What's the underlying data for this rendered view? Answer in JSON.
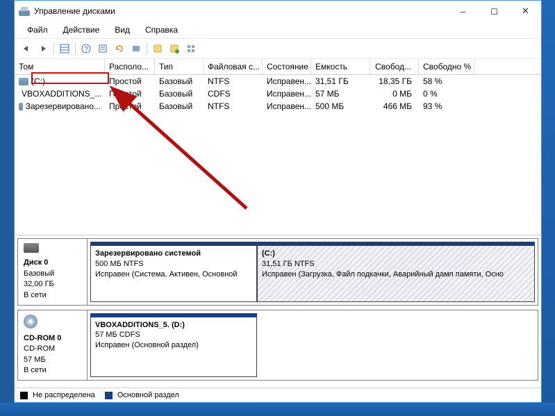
{
  "window": {
    "title": "Управление дисками"
  },
  "menu": {
    "file": "Файл",
    "action": "Действие",
    "view": "Вид",
    "help": "Справка"
  },
  "columns": {
    "volume": "Том",
    "layout": "Располо...",
    "type": "Тип",
    "fs": "Файловая с...",
    "status": "Состояние",
    "capacity": "Емкость",
    "free": "Свобод...",
    "freepct": "Свободно %"
  },
  "volumes": [
    {
      "name": "(C:)",
      "layout": "Простой",
      "type": "Базовый",
      "fs": "NTFS",
      "status": "Исправен...",
      "capacity": "31,51 ГБ",
      "free": "18,35 ГБ",
      "freepct": "58 %",
      "icon": "disk"
    },
    {
      "name": "VBOXADDITIONS_...",
      "layout": "Простой",
      "type": "Базовый",
      "fs": "CDFS",
      "status": "Исправен...",
      "capacity": "57 МБ",
      "free": "0 МБ",
      "freepct": "0 %",
      "icon": "cd"
    },
    {
      "name": "Зарезервировано...",
      "layout": "Простой",
      "type": "Базовый",
      "fs": "NTFS",
      "status": "Исправен...",
      "capacity": "500 МБ",
      "free": "466 МБ",
      "freepct": "93 %",
      "icon": "disk"
    }
  ],
  "disk0": {
    "label": "Диск 0",
    "type": "Базовый",
    "size": "32,00 ГБ",
    "status": "В сети",
    "part1": {
      "name": "Зарезервировано системой",
      "info": "500 МБ NTFS",
      "status": "Исправен (Система, Активен, Основной"
    },
    "part2": {
      "name": "(C:)",
      "info": "31,51 ГБ NTFS",
      "status": "Исправен (Загрузка, Файл подкачки, Аварийный дамп памяти, Осно"
    }
  },
  "cdrom": {
    "label": "CD-ROM 0",
    "type": "CD-ROM",
    "size": "57 МБ",
    "status": "В сети",
    "part": {
      "name": "VBOXADDITIONS_5.  (D:)",
      "info": "57 МБ CDFS",
      "status": "Исправен (Основной раздел)"
    }
  },
  "legend": {
    "unallocated": "Не распределена",
    "primary": "Основной раздел"
  },
  "colors": {
    "primary_stripe": "#1a3d7c",
    "unallocated": "#000000"
  }
}
